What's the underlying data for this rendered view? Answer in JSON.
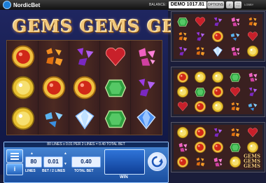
{
  "topbar": {
    "brand": "NordicBet",
    "balance_label": "BALANCE:",
    "balance_value": "DEMO 1017.81",
    "options_label": "OPTIONS",
    "lobby_label": "LOBBY"
  },
  "game": {
    "title": "GEMS GEMS GEMS",
    "reels": [
      [
        "red-round",
        "yellow-round",
        "yellow-round"
      ],
      [
        "orange-pieces",
        "red-round",
        "blue-pieces"
      ],
      [
        "purple-pieces",
        "red-round",
        "white-diamond"
      ],
      [
        "red-heart",
        "green-emerald",
        "green-emerald"
      ],
      [
        "pink-pieces",
        "purple-pieces",
        "blue-diamond"
      ]
    ]
  },
  "panel": {
    "info_text": "80 LINES x 0.01 PER 2 LINES = 0.40 TOTAL BET",
    "lines_value": "80",
    "lines_label": "LINES",
    "bet_value": "0.01",
    "bet_label": "BET / 2 LINES",
    "total_value": "0.40",
    "total_label": "TOTAL BET",
    "win_label": "WIN",
    "info_button": "i"
  },
  "thumbs": [
    {
      "rows": [
        [
          "green-emerald",
          "red-heart",
          "purple-pieces",
          "pink-pieces",
          "orange-pieces"
        ],
        [
          "orange-pieces",
          "purple-pieces",
          "red-round",
          "blue-pieces",
          "red-heart"
        ],
        [
          "purple-pieces",
          "orange-pieces",
          "white-diamond",
          "pink-pieces",
          "yellow-round"
        ]
      ]
    },
    {
      "rows": [
        [
          "red-round",
          "yellow-round",
          "yellow-round",
          "green-emerald",
          "pink-pieces"
        ],
        [
          "yellow-round",
          "green-emerald",
          "red-round",
          "red-heart",
          "purple-pieces"
        ],
        [
          "red-heart",
          "red-round",
          "yellow-round",
          "orange-pieces",
          "blue-pieces"
        ]
      ]
    },
    {
      "rows": [
        [
          "yellow-round",
          "red-round",
          "purple-pieces",
          "orange-pieces",
          "red-heart"
        ],
        [
          "pink-pieces",
          "red-round",
          "red-round",
          "green-emerald",
          "yellow-round"
        ],
        [
          "red-round",
          "orange-pieces",
          "pink-pieces",
          "yellow-round",
          "logo"
        ]
      ]
    }
  ],
  "colors": {
    "panel_blue": "#2f74d8",
    "title_gold": "#f1c77b",
    "reel_bg": "#3a1f1f"
  }
}
